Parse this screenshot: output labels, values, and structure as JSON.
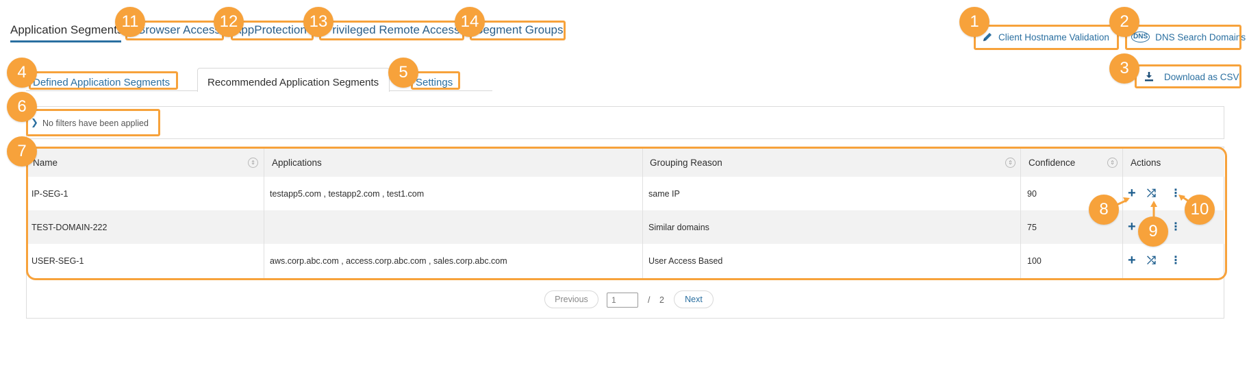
{
  "top_tabs": [
    {
      "label": "Application Segments"
    },
    {
      "label": "Browser Access"
    },
    {
      "label": "AppProtection"
    },
    {
      "label": "Privileged Remote Access"
    },
    {
      "label": "Segment Groups"
    }
  ],
  "actions": {
    "client_hostname": "Client Hostname Validation",
    "dns_search": "DNS Search Domains",
    "dns_icon_text": "DNS",
    "download_csv": "Download as CSV"
  },
  "sub_tabs": [
    {
      "label": "Defined Application Segments"
    },
    {
      "label": "Recommended Application Segments"
    },
    {
      "label": "Settings"
    }
  ],
  "filter": {
    "text": "No filters have been applied"
  },
  "table": {
    "headers": {
      "name": "Name",
      "applications": "Applications",
      "grouping_reason": "Grouping Reason",
      "confidence": "Confidence",
      "actions": "Actions"
    },
    "rows": [
      {
        "name": "IP-SEG-1",
        "applications": "testapp5.com , testapp2.com , test1.com",
        "grouping_reason": "same IP",
        "confidence": "90"
      },
      {
        "name": "TEST-DOMAIN-222",
        "applications": "",
        "grouping_reason": "Similar domains",
        "confidence": "75"
      },
      {
        "name": "USER-SEG-1",
        "applications": "aws.corp.abc.com , access.corp.abc.com , sales.corp.abc.com",
        "grouping_reason": "User Access Based",
        "confidence": "100"
      }
    ]
  },
  "pagination": {
    "previous": "Previous",
    "page_value": "1",
    "separator": "/",
    "total": "2",
    "next": "Next"
  },
  "callouts": [
    "1",
    "2",
    "3",
    "4",
    "5",
    "6",
    "7",
    "8",
    "9",
    "10",
    "11",
    "12",
    "13",
    "14"
  ],
  "colors": {
    "accent": "#2a6fa0",
    "callout": "#f7a23b"
  }
}
